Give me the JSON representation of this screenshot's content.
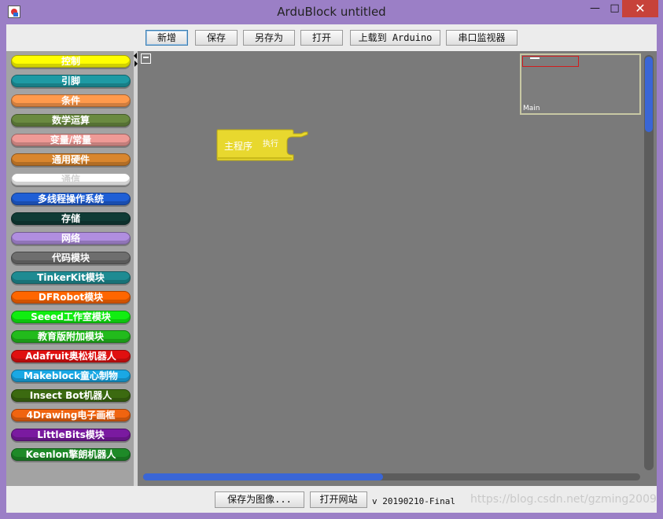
{
  "window": {
    "title": "ArduBlock untitled",
    "minimize": "—",
    "maximize": "□",
    "close": "✕"
  },
  "toolbar": {
    "new": "新增",
    "save": "保存",
    "save_as": "另存为",
    "open": "打开",
    "upload": "上载到 Arduino",
    "serial_monitor": "串口监视器"
  },
  "palette": [
    {
      "label": "控制",
      "color": "#ffff00",
      "text_color": "#ffffff"
    },
    {
      "label": "引脚",
      "color": "#1e9aa4",
      "text_color": "#ffffff"
    },
    {
      "label": "条件",
      "color": "#ff9a4c",
      "text_color": "#ffffff"
    },
    {
      "label": "数学运算",
      "color": "#6a8a40",
      "text_color": "#ffffff"
    },
    {
      "label": "变量/常量",
      "color": "#ee9a96",
      "text_color": "#ffffff"
    },
    {
      "label": "通用硬件",
      "color": "#d9862e",
      "text_color": "#ffffff"
    },
    {
      "label": "通信",
      "color": "#ffffff",
      "text_color": "#d0d0d0"
    },
    {
      "label": "多线程操作系统",
      "color": "#1f5fd6",
      "text_color": "#ffffff"
    },
    {
      "label": "存储",
      "color": "#0f3b36",
      "text_color": "#ffffff"
    },
    {
      "label": "网络",
      "color": "#b08ee0",
      "text_color": "#ffffff"
    },
    {
      "label": "代码模块",
      "color": "#6e6e6e",
      "text_color": "#ffffff"
    },
    {
      "label": "TinkerKit模块",
      "color": "#1e8b92",
      "text_color": "#ffffff"
    },
    {
      "label": "DFRobot模块",
      "color": "#ff6600",
      "text_color": "#ffffff"
    },
    {
      "label": "Seeed工作室模块",
      "color": "#11ee11",
      "text_color": "#ffffff"
    },
    {
      "label": "教育版附加模块",
      "color": "#22bb1c",
      "text_color": "#ffffff"
    },
    {
      "label": "Adafruit奥松机器人",
      "color": "#e01010",
      "text_color": "#ffffff"
    },
    {
      "label": "Makeblock童心制物",
      "color": "#1aa8e4",
      "text_color": "#ffffff"
    },
    {
      "label": "Insect Bot机器人",
      "color": "#3b6a10",
      "text_color": "#ffffff"
    },
    {
      "label": "4Drawing电子画框",
      "color": "#f06410",
      "text_color": "#ffffff"
    },
    {
      "label": "LittleBits模块",
      "color": "#7a1aa0",
      "text_color": "#ffffff"
    },
    {
      "label": "Keenlon擎朗机器人",
      "color": "#1e8a28",
      "text_color": "#ffffff"
    }
  ],
  "canvas": {
    "main_block": {
      "label": "主程序",
      "sub_label": "执行",
      "color": "#e8d82e"
    },
    "minimap_label": "Main",
    "background": "#7a7a7a",
    "scroll_accent": "#3a66d6"
  },
  "bottombar": {
    "save_image": "保存为图像...",
    "open_website": "打开网站",
    "version": "v 20190210-Final",
    "watermark": "https://blog.csdn.net/gzming2009"
  }
}
